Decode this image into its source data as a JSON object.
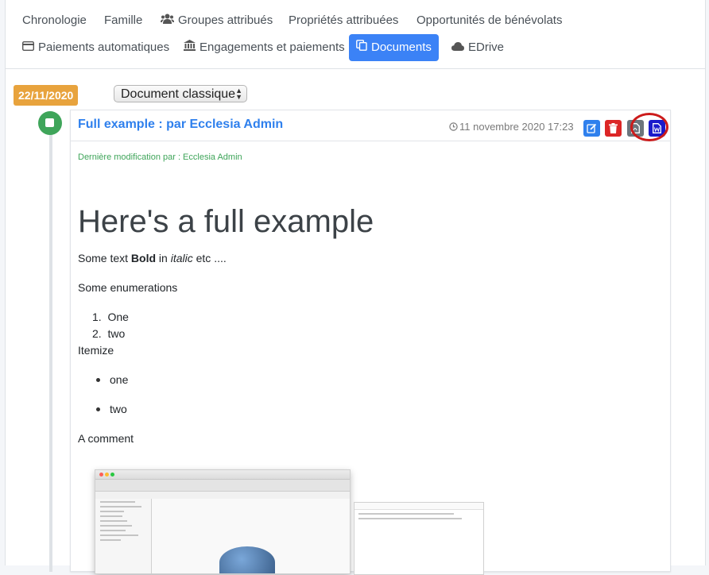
{
  "nav": {
    "row1": [
      {
        "label": "Chronologie",
        "icon": null
      },
      {
        "label": "Famille",
        "icon": null
      },
      {
        "label": "Groupes attribués",
        "icon": "users-icon"
      },
      {
        "label": "Propriétés attribuées",
        "icon": null
      },
      {
        "label": "Opportunités de bénévolats",
        "icon": null
      }
    ],
    "row2": [
      {
        "label": "Paiements automatiques",
        "icon": "credit-card-icon"
      },
      {
        "label": "Engagements et paiements",
        "icon": "bank-icon"
      },
      {
        "label": "Documents",
        "icon": "copy-icon",
        "active": true
      },
      {
        "label": "EDrive",
        "icon": "cloud-icon"
      }
    ]
  },
  "timeline": {
    "date_badge": "22/11/2020",
    "doc_type_select": "Document classique"
  },
  "card": {
    "title": "Full example : par Ecclesia Admin",
    "date": "11 novembre 2020 17:23",
    "actions": [
      {
        "name": "edit-button",
        "icon": "edit-icon",
        "color": "#2f80ed"
      },
      {
        "name": "delete-button",
        "icon": "trash-icon",
        "color": "#dc2626"
      },
      {
        "name": "pdf-button",
        "icon": "pdf-icon",
        "color": "#6c757d"
      },
      {
        "name": "word-export-button",
        "icon": "word-file-icon",
        "color": "#1a1acb"
      }
    ],
    "modified_by": "Dernière modification par : Ecclesia Admin",
    "content": {
      "heading": "Here's a full example",
      "text_prefix": "Some text ",
      "text_bold": "Bold",
      "text_in": " in ",
      "text_italic": "italic",
      "text_suffix": " etc ....",
      "enumerations_label": "Some enumerations",
      "enumeration_items": [
        "One",
        "two"
      ],
      "itemize_label": "Itemize",
      "itemize_items": [
        "one",
        "two"
      ],
      "comment": "A comment"
    }
  },
  "colors": {
    "accent": "#3b82f6",
    "date_badge": "#e8a33d",
    "timeline_dot": "#3fa55a",
    "highlight_circle": "#cc1b1b"
  }
}
